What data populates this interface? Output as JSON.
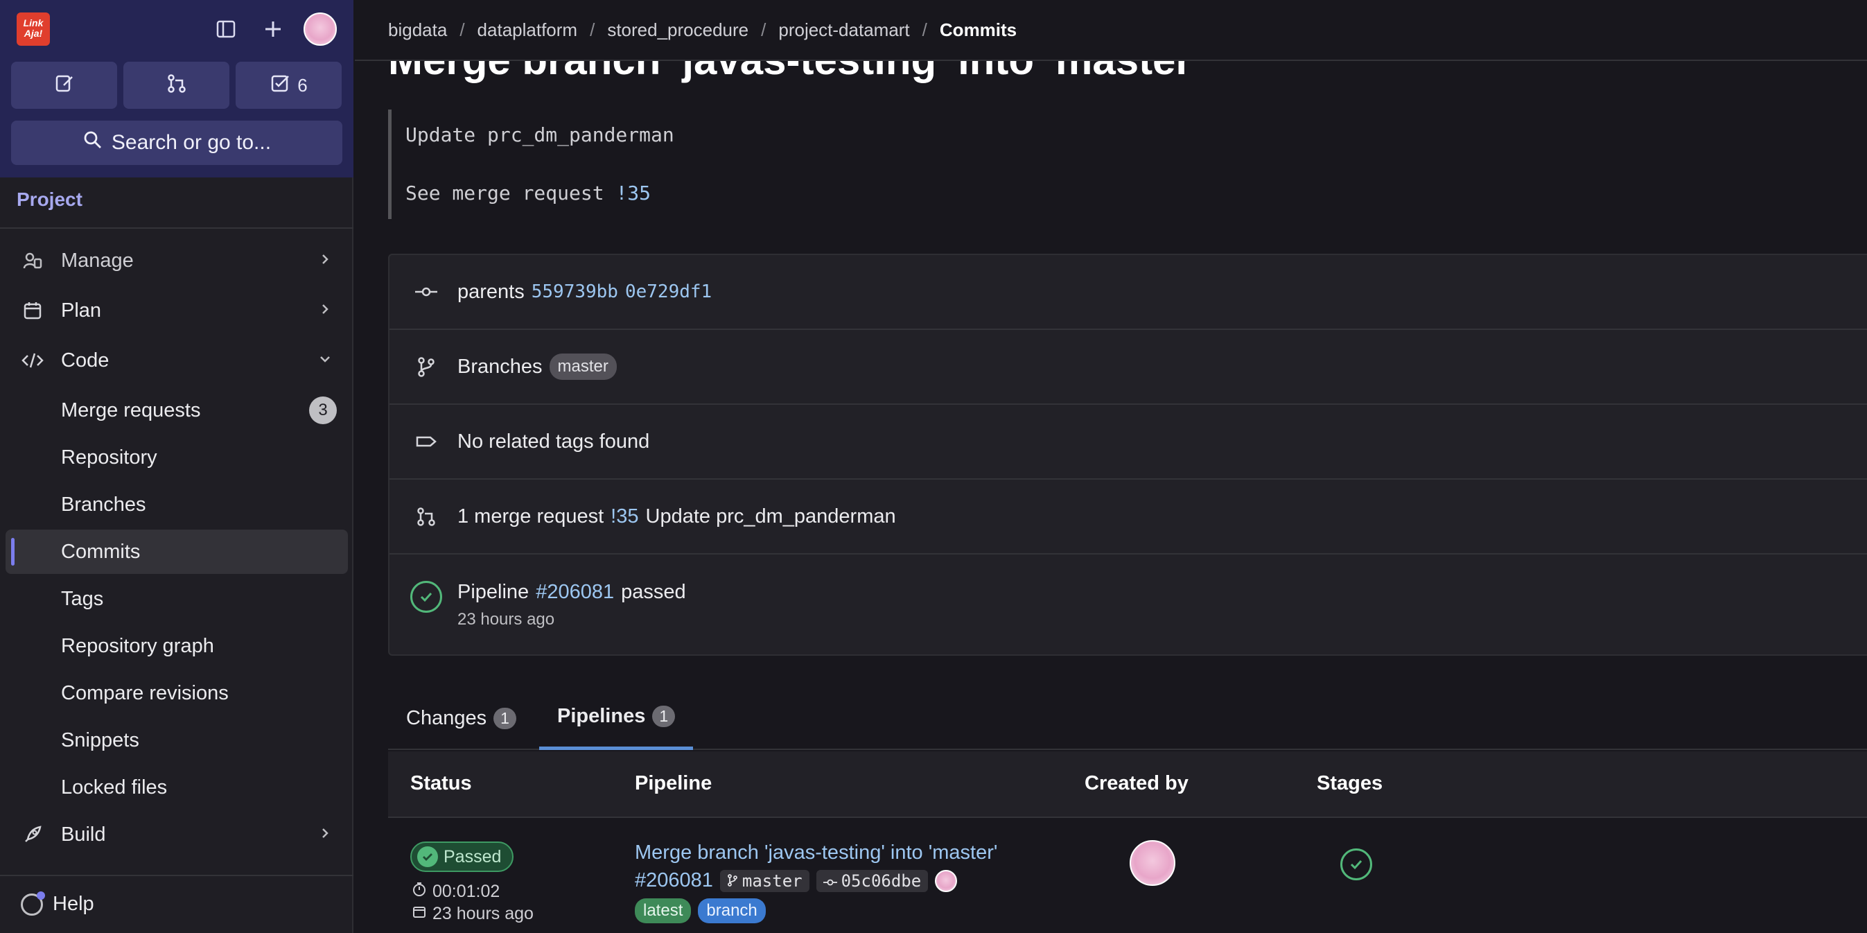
{
  "sidebar": {
    "logo_text": "LinkAja!",
    "todo_count": "6",
    "search_label": "Search or go to...",
    "section_title": "Project",
    "items": [
      {
        "label": "Manage"
      },
      {
        "label": "Plan"
      },
      {
        "label": "Code"
      },
      {
        "label": "Merge requests",
        "badge": "3"
      },
      {
        "label": "Repository"
      },
      {
        "label": "Branches"
      },
      {
        "label": "Commits"
      },
      {
        "label": "Tags"
      },
      {
        "label": "Repository graph"
      },
      {
        "label": "Compare revisions"
      },
      {
        "label": "Snippets"
      },
      {
        "label": "Locked files"
      },
      {
        "label": "Build"
      }
    ],
    "help_label": "Help"
  },
  "breadcrumb": [
    "bigdata",
    "dataplatform",
    "stored_procedure",
    "project-datamart",
    "Commits"
  ],
  "commit": {
    "title": "Merge branch 'javas-testing' into 'master'",
    "message_line1": "Update prc_dm_panderman",
    "message_line2_prefix": "See merge request ",
    "message_line2_link": "!35"
  },
  "info": {
    "parents_label": "parents",
    "parent1": "559739bb",
    "parent2": "0e729df1",
    "branches_label": "Branches",
    "branch": "master",
    "tags_text": "No related tags found",
    "mr_prefix": "1 merge request",
    "mr_link": "!35",
    "mr_title": "Update prc_dm_panderman",
    "pipeline_prefix": "Pipeline",
    "pipeline_link": "#206081",
    "pipeline_status": "passed",
    "pipeline_time": "23 hours ago"
  },
  "tabs": [
    {
      "label": "Changes",
      "count": "1"
    },
    {
      "label": "Pipelines",
      "count": "1"
    }
  ],
  "table": {
    "headers": [
      "Status",
      "Pipeline",
      "Created by",
      "Stages"
    ],
    "row": {
      "status": "Passed",
      "duration": "00:01:02",
      "finished": "23 hours ago",
      "title": "Merge branch 'javas-testing' into 'master'",
      "id": "#206081",
      "ref": "master",
      "sha": "05c06dbe",
      "labels": [
        "latest",
        "branch"
      ]
    }
  },
  "colors": {
    "accent": "#7b7ded",
    "success": "#52b87a",
    "link": "#9dc7f1"
  }
}
